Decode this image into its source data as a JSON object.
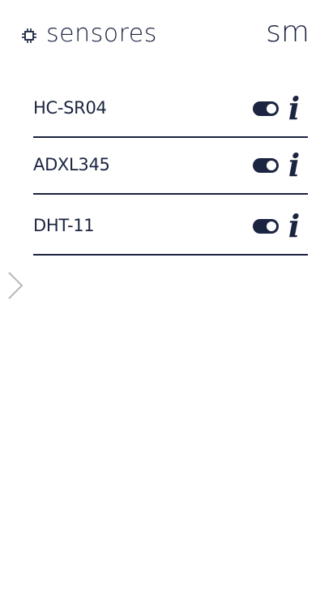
{
  "header": {
    "title": "sensores",
    "brand": "sm",
    "title_icon": "chip-icon"
  },
  "sensors": [
    {
      "name": "HC-SR04",
      "enabled": true,
      "info_icon": "info-icon"
    },
    {
      "name": "ADXL345",
      "enabled": true,
      "info_icon": "info-icon"
    },
    {
      "name": "DHT-11",
      "enabled": true,
      "info_icon": "info-icon"
    }
  ],
  "nav": {
    "expand_icon": "chevron-right-icon"
  },
  "colors": {
    "primary": "#1b2440",
    "background": "#ffffff",
    "arrow": "#b8b8b8"
  }
}
